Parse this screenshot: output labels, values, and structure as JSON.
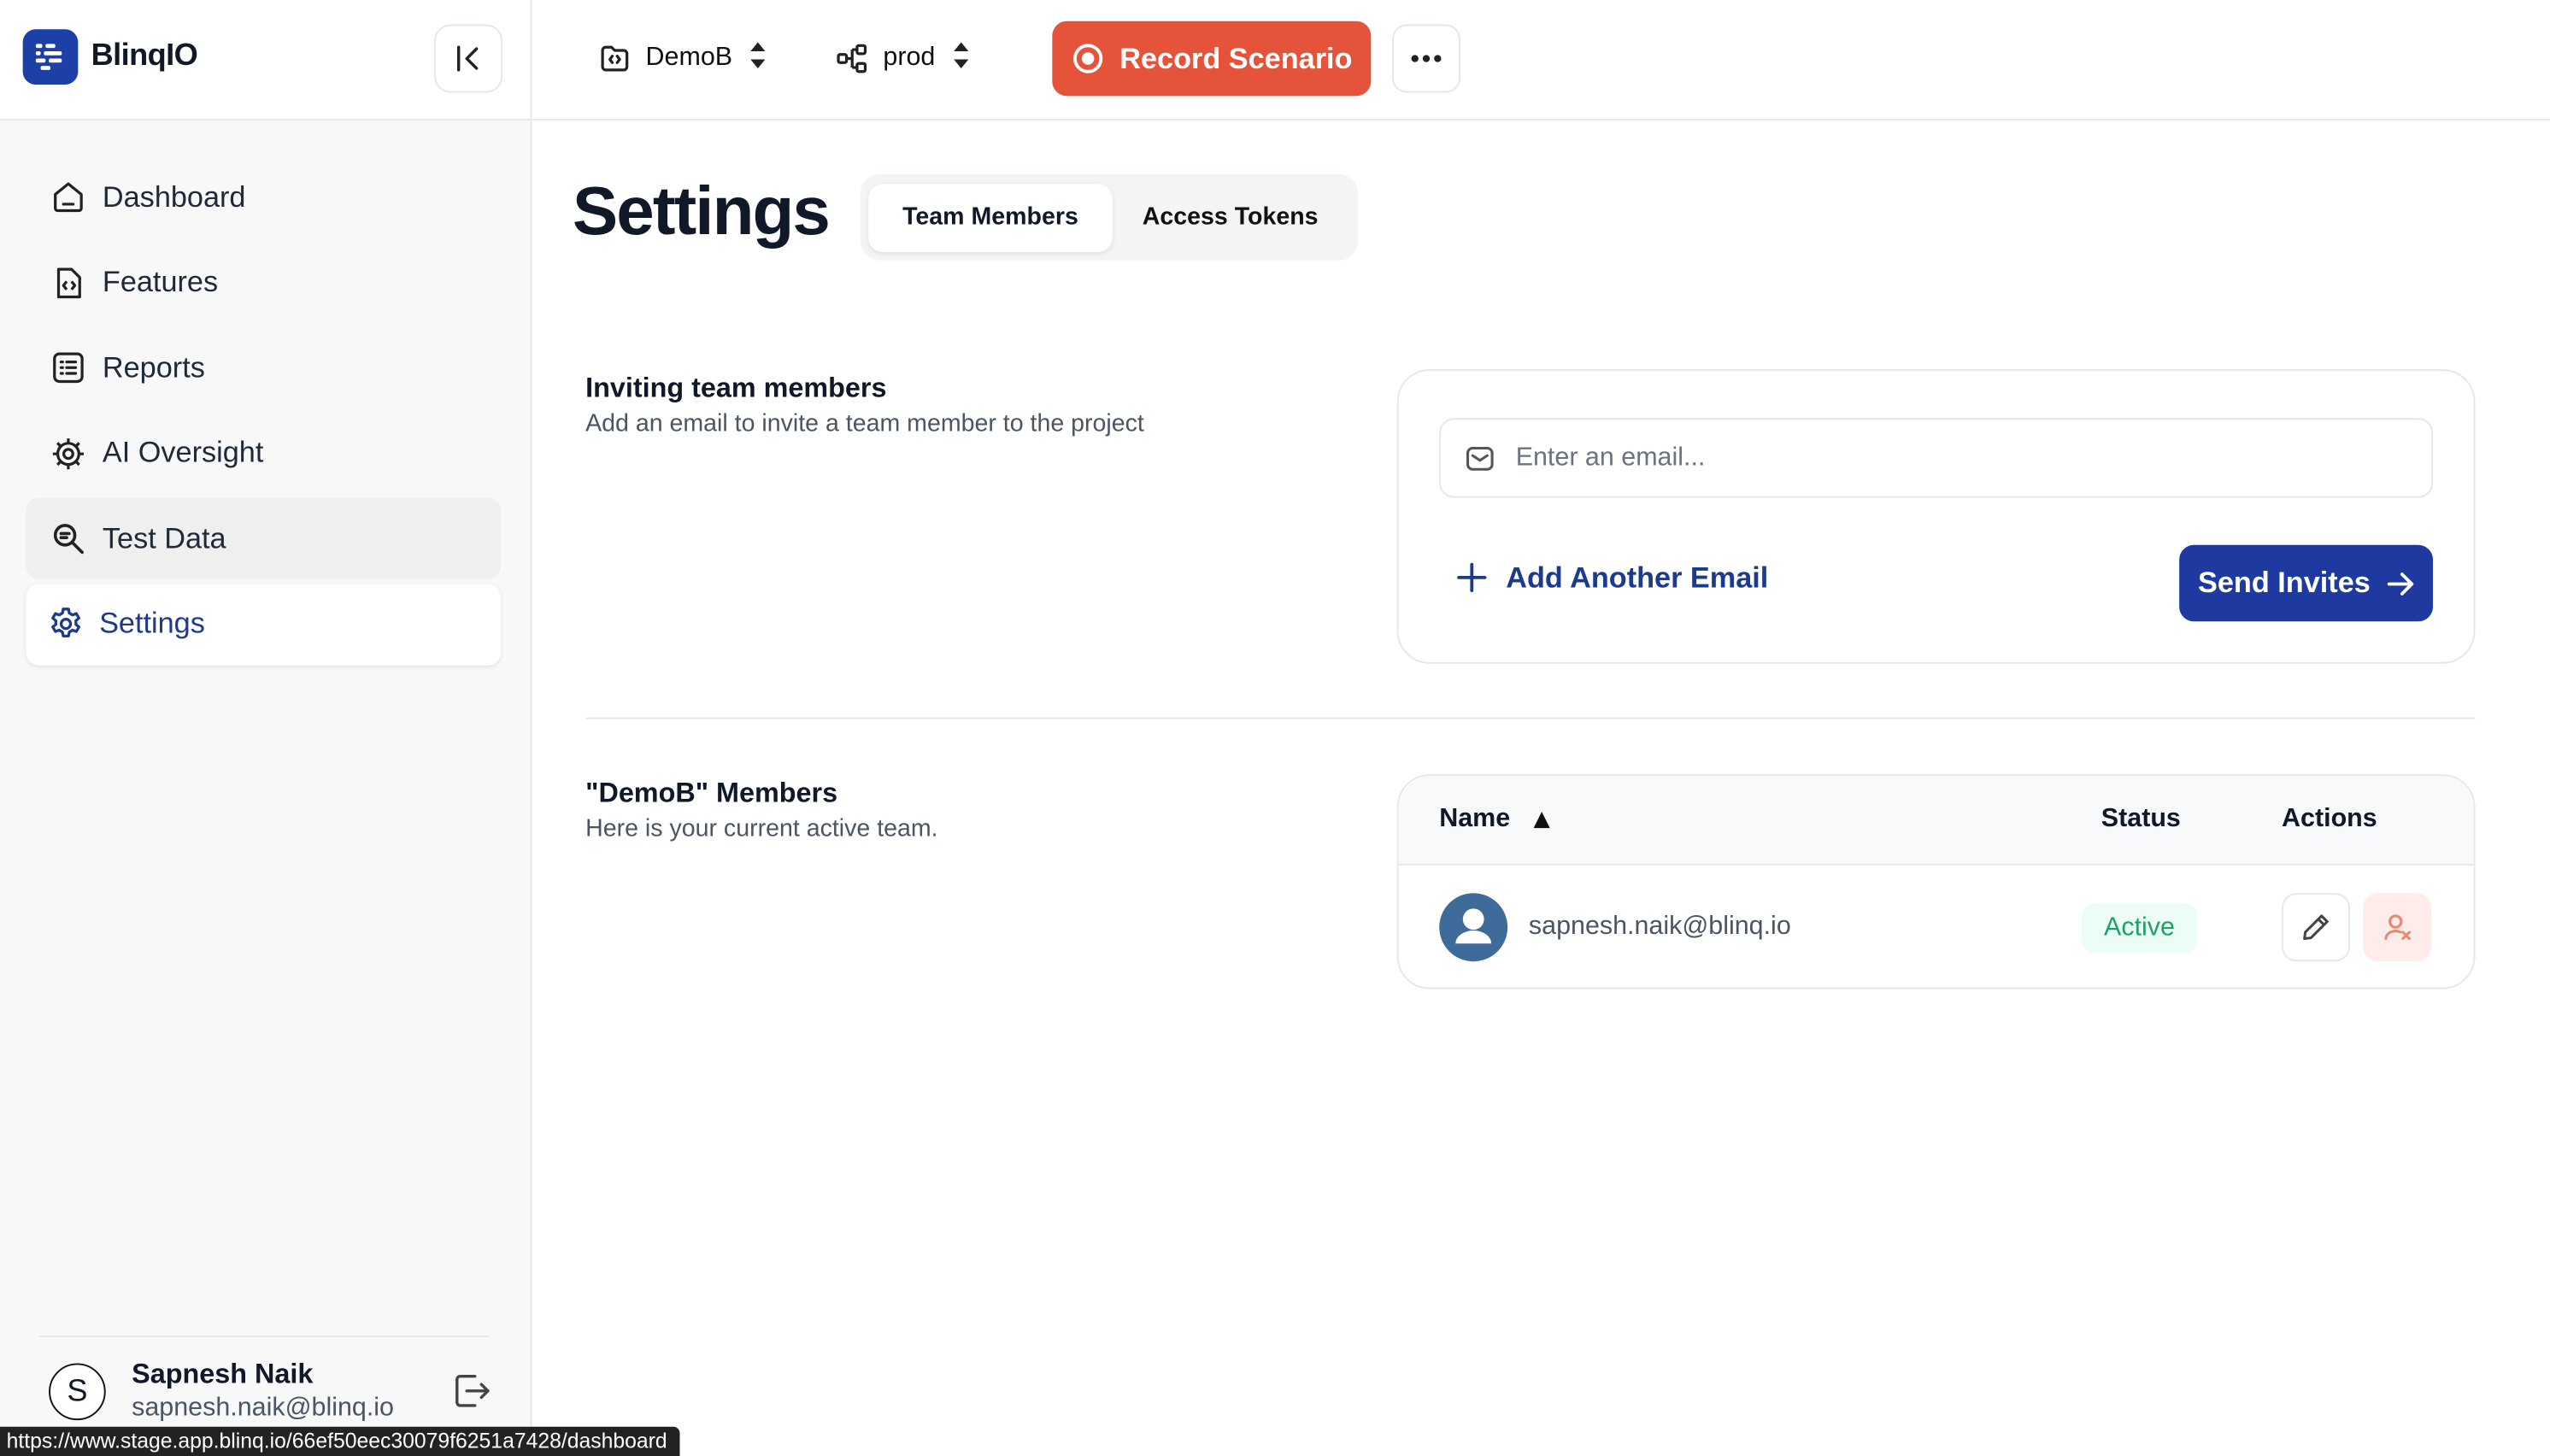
{
  "brand": {
    "name": "BlinqIO"
  },
  "sidebar": {
    "items": [
      {
        "label": "Dashboard",
        "icon": "home-icon"
      },
      {
        "label": "Features",
        "icon": "feature-file-icon"
      },
      {
        "label": "Reports",
        "icon": "list-icon"
      },
      {
        "label": "AI Oversight",
        "icon": "cog-chip-icon"
      },
      {
        "label": "Test Data",
        "icon": "search-doc-icon"
      },
      {
        "label": "Settings",
        "icon": "settings-icon"
      }
    ],
    "active": "Settings",
    "hovered": "Test Data"
  },
  "user": {
    "initial": "S",
    "name": "Sapnesh Naik",
    "email": "sapnesh.naik@blinq.io"
  },
  "status_url": "https://www.stage.app.blinq.io/66ef50eec30079f6251a7428/dashboard",
  "topbar": {
    "project": "DemoB",
    "environment": "prod",
    "record_label": "Record Scenario"
  },
  "page": {
    "title": "Settings",
    "tabs": [
      {
        "label": "Team Members",
        "active": true
      },
      {
        "label": "Access Tokens",
        "active": false
      }
    ]
  },
  "invite": {
    "title": "Inviting team members",
    "subtitle": "Add an email to invite a team member to the project",
    "email_value": "",
    "email_placeholder": "Enter an email...",
    "add_label": "Add Another Email",
    "send_label": "Send Invites"
  },
  "members": {
    "title": "\"DemoB\" Members",
    "subtitle": "Here is your current active team.",
    "columns": {
      "name": "Name",
      "status": "Status",
      "actions": "Actions"
    },
    "rows": [
      {
        "email": "sapnesh.naik@blinq.io",
        "status": "Active"
      }
    ]
  },
  "colors": {
    "brand": "#1d3fa8",
    "record": "#e5533a",
    "primary": "#1e3aa0",
    "active_badge_bg": "#ecfdf5",
    "active_badge_text": "#22a06b"
  }
}
